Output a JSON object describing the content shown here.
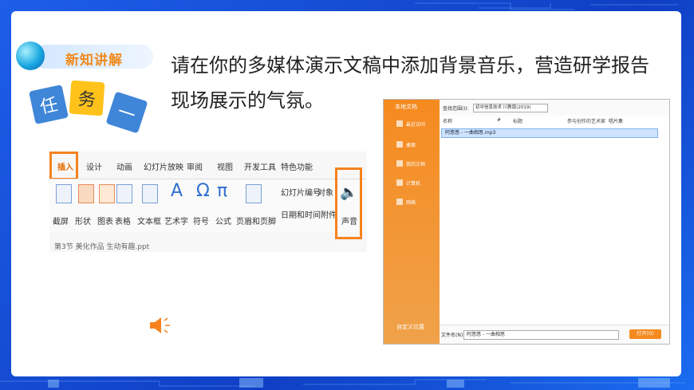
{
  "badge": {
    "title": "新知讲解"
  },
  "task": {
    "tile1": "任",
    "tile2": "务",
    "tile3": "一"
  },
  "main_text": "请在你的多媒体演示文稿中添加背景音乐，营造研学报告现场展示的气氛。",
  "ribbon": {
    "tabs": [
      "插入",
      "设计",
      "动画",
      "幻灯片放映",
      "审阅",
      "视图",
      "开发工具",
      "特色功能"
    ],
    "active_tab": "插入",
    "tools": [
      "截屏",
      "形状",
      "图表",
      "表格",
      "文本框",
      "艺术字",
      "符号",
      "公式",
      "页眉和页脚",
      "日期和时间",
      "附件",
      "声音"
    ],
    "slide_number": "幻灯片编号",
    "object": "对象",
    "doc_tab": "第3节 美化作品 生动有趣.ppt"
  },
  "dialog": {
    "sidebar_title": "本地文档",
    "sidebar_items": [
      "最近访问",
      "桌面",
      "我的文档",
      "计算机",
      "网络"
    ],
    "look_in_label": "查找范围(I):",
    "look_in_value": "初中信息技术 川教版(2019)",
    "columns": [
      "名称",
      "#",
      "标题",
      "参与创作的艺术家",
      "唱片集"
    ],
    "file": "阿悠悠 - 一曲相思.mp3",
    "filename_label": "文件名(N):",
    "filename_value": "阿悠悠 - 一曲相思",
    "custom_location": "自定义位置",
    "open_button": "打开(O)"
  },
  "colors": {
    "accent": "#f5821f",
    "frame": "#1d5ee8",
    "tile_blue": "#3f86d8",
    "tile_yellow": "#ffc21a"
  }
}
